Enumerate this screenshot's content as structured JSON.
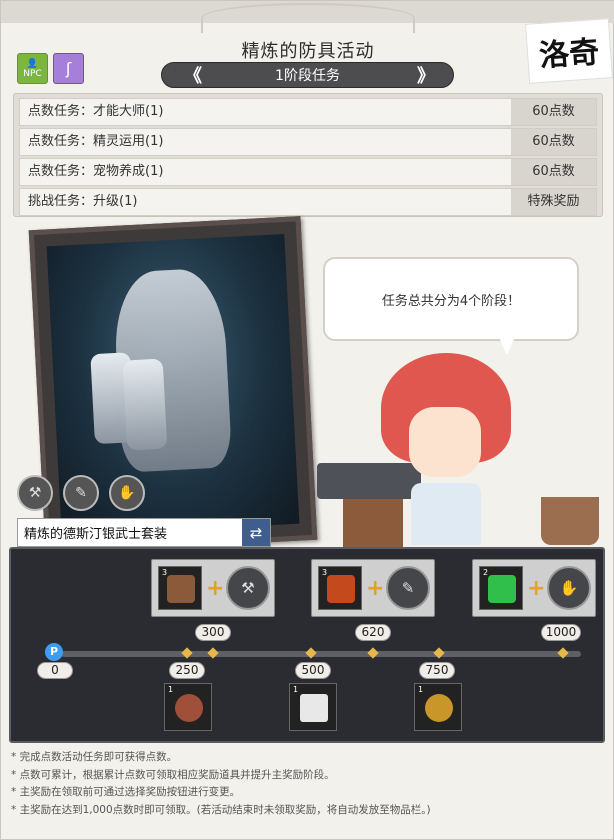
{
  "title": "精炼的防具活动",
  "stage": {
    "label": "1阶段任务",
    "prev_arrow": "《",
    "next_arrow": "》"
  },
  "npc_button_label": "NPC",
  "logo_text": "洛奇",
  "tasks": [
    {
      "name": "点数任务：才能大师(1)",
      "reward": "60点数"
    },
    {
      "name": "点数任务：精灵运用(1)",
      "reward": "60点数"
    },
    {
      "name": "点数任务：宠物养成(1)",
      "reward": "60点数"
    },
    {
      "name": "挑战任务：升级(1)",
      "reward": "特殊奖励"
    }
  ],
  "item_name": "精炼的德斯汀银武士套装",
  "bubble_text": "任务总共分为4个阶段！",
  "rewards": {
    "main_boxes": [
      {
        "count": "3",
        "item": "chest-icon",
        "points": "300"
      },
      {
        "count": "3",
        "item": "lantern-icon",
        "points": "620"
      },
      {
        "count": "2",
        "item": "potion-icon",
        "points": "1000"
      }
    ],
    "progress": {
      "start": "0",
      "marker": "P"
    },
    "mini": [
      {
        "count": "1",
        "points": "250",
        "item": "bag-icon"
      },
      {
        "count": "1",
        "points": "500",
        "item": "giftbox-icon"
      },
      {
        "count": "1",
        "points": "750",
        "item": "orb-icon"
      }
    ]
  },
  "notes": [
    "* 完成点数活动任务即可获得点数。",
    "* 点数可累计，根据累计点数可领取相应奖励道具并提升主奖励阶段。",
    "* 主奖励在领取前可通过选择奖励按钮进行变更。",
    "* 主奖励在达到1,000点数时即可领取。(若活动结束时未领取奖励，将自动发放至物品栏。)"
  ]
}
